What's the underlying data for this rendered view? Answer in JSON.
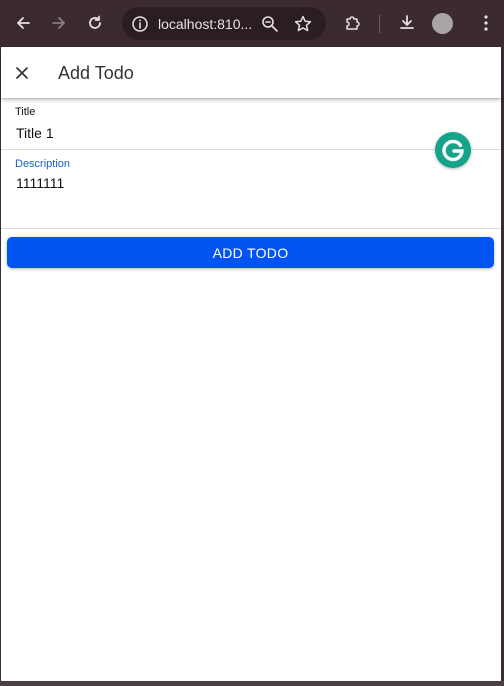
{
  "browser": {
    "address": "localhost:810...",
    "icons": [
      "back-arrow-icon",
      "forward-arrow-icon",
      "reload-icon",
      "site-info-icon",
      "zoom-icon",
      "bookmark-star-icon",
      "extensions-icon",
      "download-icon",
      "profile-avatar",
      "menu-dots-icon"
    ]
  },
  "header": {
    "close_symbol": "×",
    "title": "Add Todo"
  },
  "form": {
    "title_label": "Title",
    "title_value": "Title 1",
    "description_label": "Description",
    "description_value": "1111111",
    "submit_label": "ADD TODO"
  },
  "colors": {
    "accent": "#0055f2",
    "description_label": "#1565c0",
    "grammarly": "#15a38a"
  }
}
